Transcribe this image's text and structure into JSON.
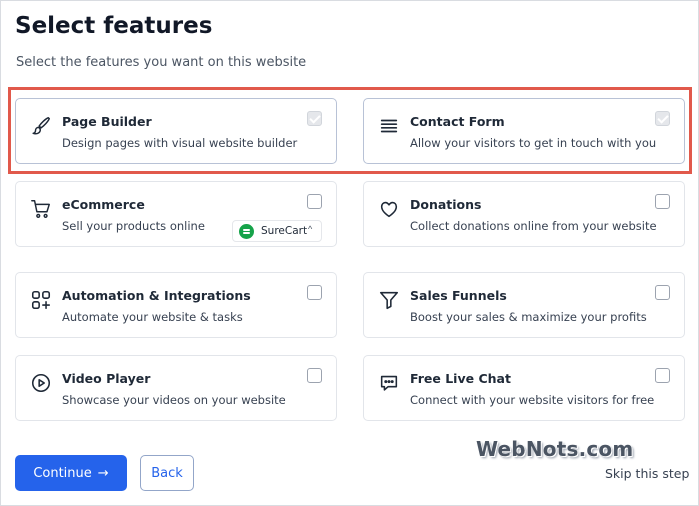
{
  "header": {
    "title": "Select features",
    "subtitle": "Select the features you want on this website"
  },
  "features": [
    {
      "icon": "brush-icon",
      "title": "Page Builder",
      "desc": "Design pages with visual website builder",
      "checked": true
    },
    {
      "icon": "list-icon",
      "title": "Contact Form",
      "desc": "Allow your visitors to get in touch with you",
      "checked": true
    },
    {
      "icon": "cart-icon",
      "title": "eCommerce",
      "desc": "Sell your products online",
      "checked": false
    },
    {
      "icon": "heart-icon",
      "title": "Donations",
      "desc": "Collect donations online from your website",
      "checked": false
    },
    {
      "icon": "apps-icon",
      "title": "Automation & Integrations",
      "desc": "Automate your website & tasks",
      "checked": false
    },
    {
      "icon": "funnel-icon",
      "title": "Sales Funnels",
      "desc": "Boost your sales & maximize your profits",
      "checked": false
    },
    {
      "icon": "play-icon",
      "title": "Video Player",
      "desc": "Showcase your videos on your website",
      "checked": false
    },
    {
      "icon": "chat-icon",
      "title": "Free Live Chat",
      "desc": "Connect with your website visitors for free",
      "checked": false
    }
  ],
  "ecommerce_plugin": {
    "name": "SureCart",
    "caret": "^"
  },
  "footer": {
    "continue_label": "Continue",
    "continue_arrow": "→",
    "back_label": "Back",
    "skip_label": "Skip this step"
  },
  "watermark": "WebNots.com",
  "colors": {
    "accent": "#2563eb",
    "highlight": "#e1594b",
    "surecart": "#16a34a"
  }
}
